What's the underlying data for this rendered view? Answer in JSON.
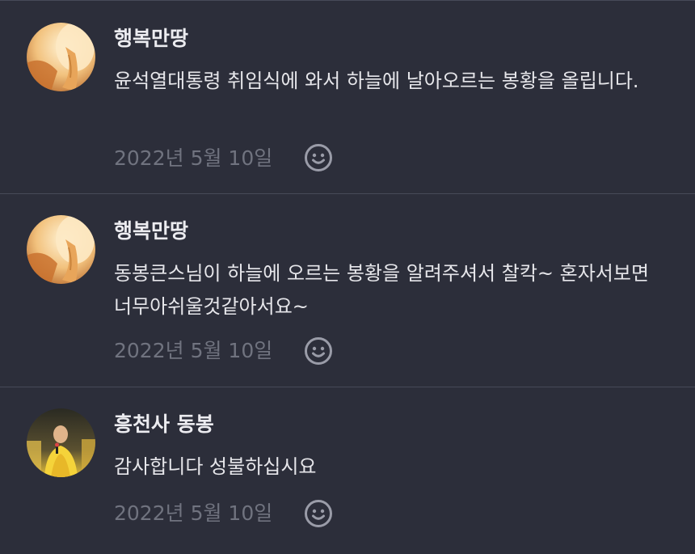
{
  "comments": [
    {
      "author": "행복만땅",
      "avatar": "praying-hands-avatar",
      "text": "윤석열대통령 취임식에 와서 하늘에 날아오르는 봉황을 올립니다.",
      "date": "2022년 5월 10일",
      "reaction_icon": "smiley-icon"
    },
    {
      "author": "행복만땅",
      "avatar": "praying-hands-avatar",
      "text": "동봉큰스님이 하늘에 오르는 봉황을 알려주셔서 찰칵~  혼자서보면 너무아쉬울것같아서요~",
      "date": "2022년 5월 10일",
      "reaction_icon": "smiley-icon"
    },
    {
      "author": "흥천사 동봉",
      "avatar": "monk-avatar",
      "text": "감사합니다 성불하십시요",
      "date": "2022년 5월 10일",
      "reaction_icon": "smiley-icon"
    }
  ],
  "colors": {
    "background": "#2c2e3a",
    "divider": "#474a58",
    "author": "#ececf0",
    "body": "#e6e6ea",
    "meta": "#70737f"
  }
}
